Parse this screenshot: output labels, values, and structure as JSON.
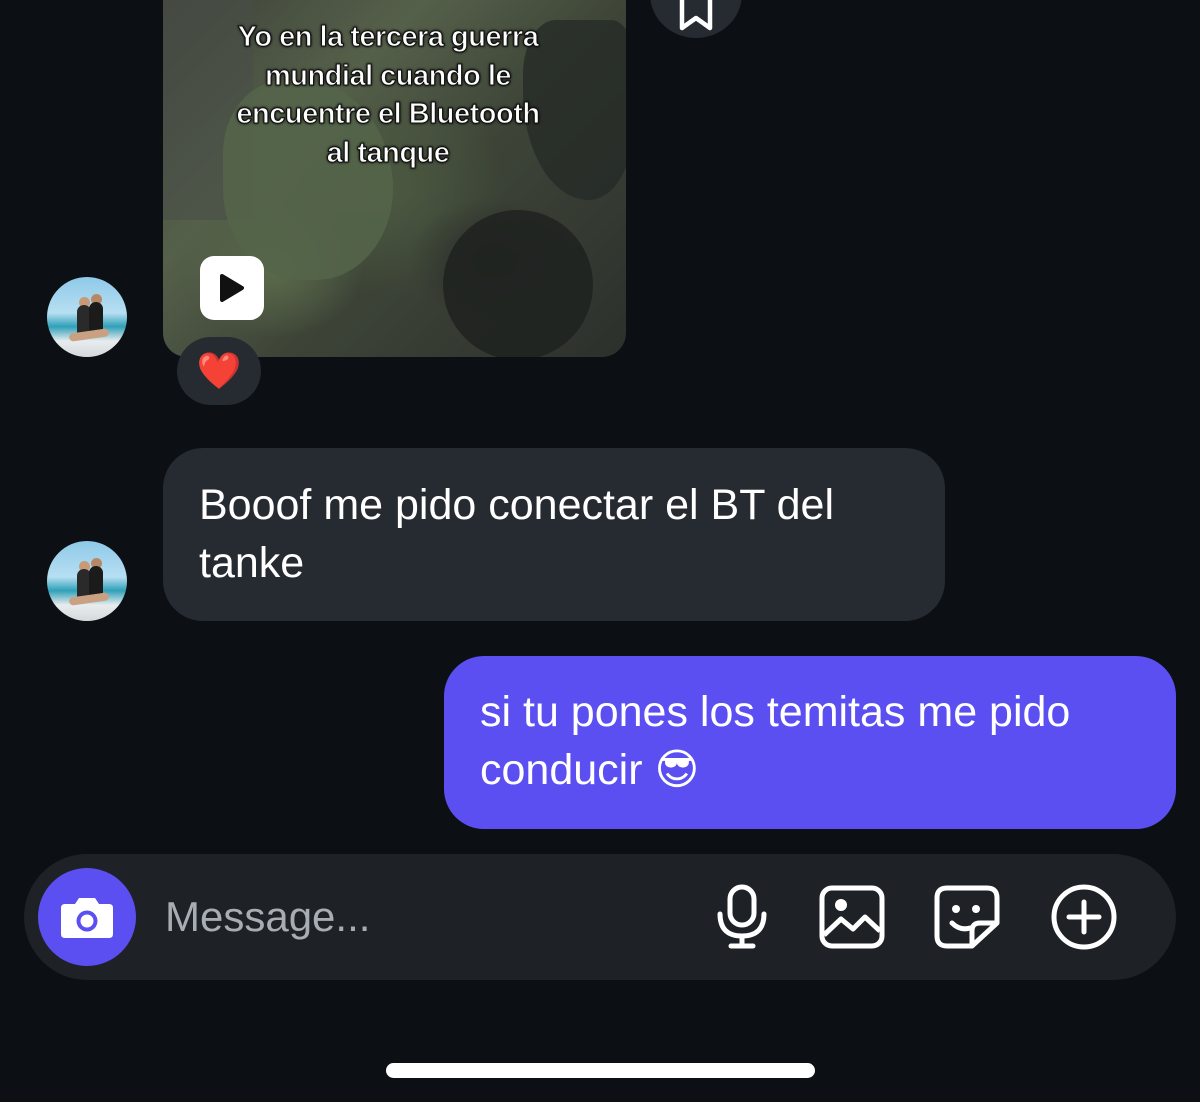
{
  "thread": {
    "messages": [
      {
        "type": "video",
        "sender": "other",
        "caption": "Yo en la tercera guerra\nmundial cuando le\nencuentre el Bluetooth\nal tanque",
        "reaction": "❤️"
      },
      {
        "type": "text",
        "sender": "other",
        "text": "Booof me pido conectar el BT del\ntanke"
      },
      {
        "type": "text",
        "sender": "me",
        "text": "si tu pones los temitas me pido\nconducir 😎"
      }
    ]
  },
  "composer": {
    "placeholder": "Message...",
    "icons": [
      "camera-icon",
      "microphone-icon",
      "gallery-icon",
      "sticker-icon",
      "add-icon"
    ]
  },
  "colors": {
    "background": "#0c1014",
    "incoming_bubble": "#262a31",
    "outgoing_bubble": "#5b4ff2",
    "composer": "#1e2226",
    "accent": "#5b4ff2"
  }
}
